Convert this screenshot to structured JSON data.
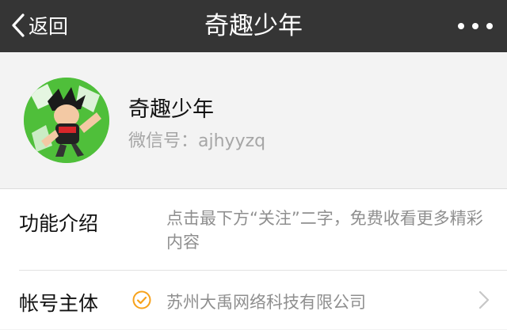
{
  "navbar": {
    "back_label": "返回",
    "title": "奇趣少年",
    "more_icon": "more-dots-icon"
  },
  "profile": {
    "name": "奇趣少年",
    "wechat_id_label": "微信号：",
    "wechat_id": "ajhyyzq"
  },
  "info": {
    "intro_label": "功能介绍",
    "intro_text": "点击最下方“关注”二字，免费收看更多精彩内容",
    "entity_label": "帐号主体",
    "entity_name": "苏州大禹网络科技有限公司",
    "verify_icon": "verified-check-icon",
    "chevron_icon": "chevron-right-icon"
  },
  "colors": {
    "navbar_bg": "#353535",
    "verify": "#f7a21b",
    "accent_green": "#4fbf3a"
  }
}
